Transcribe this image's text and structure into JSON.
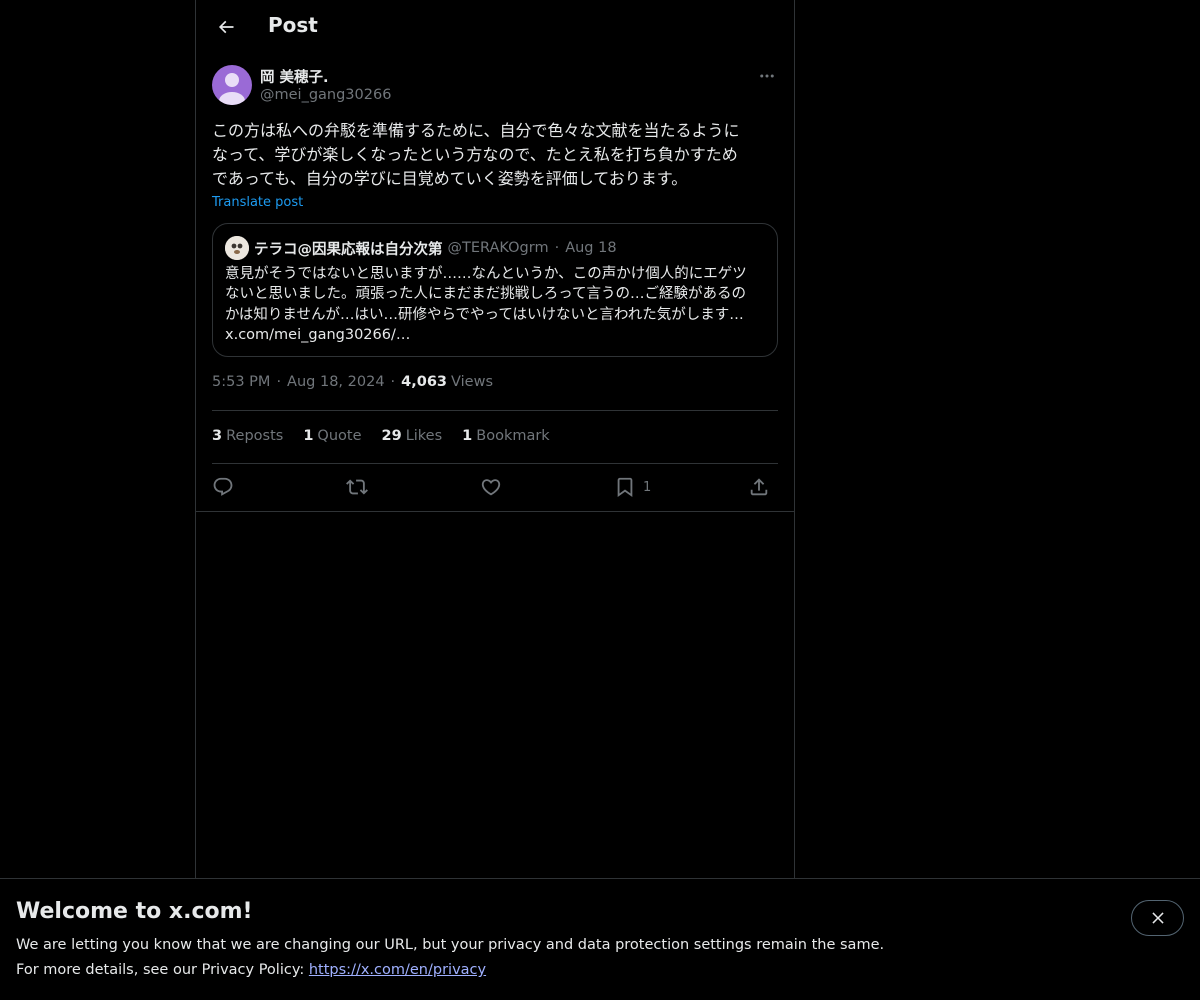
{
  "header": {
    "title": "Post"
  },
  "author": {
    "name": "岡 美穂子.",
    "handle": "@mei_gang30266"
  },
  "post": {
    "text": "この方は私への弁駁を準備するために、自分で色々な文献を当たるように\nなって、学びが楽しくなったという方なので、たとえ私を打ち負かすため\nであっても、自分の学びに目覚めていく姿勢を評価しております。",
    "translate_label": "Translate post"
  },
  "quote": {
    "name": "テラコ@因果応報は自分次第",
    "handle": "@TERAKOgrm",
    "separator": "·",
    "date": "Aug 18",
    "text": "意見がそうではないと思いますが……なんというか、この声かけ個人的にエゲツ\nないと思いました。頑張った人にまだまだ挑戦しろって言うの…ご経験があるの\nかは知りませんが…はい…研修やらでやってはいけないと言われた気がします…\nx.com/mei_gang30266/…"
  },
  "meta": {
    "time": "5:53 PM",
    "separator": "·",
    "date": "Aug 18, 2024",
    "views_count": "4,063",
    "views_label": "Views"
  },
  "stats": {
    "reposts_count": "3",
    "reposts_label": "Reposts",
    "quotes_count": "1",
    "quotes_label": "Quote",
    "likes_count": "29",
    "likes_label": "Likes",
    "bookmarks_count": "1",
    "bookmarks_label": "Bookmark"
  },
  "actions": {
    "reply_icon": "reply-icon",
    "repost_icon": "repost-icon",
    "like_icon": "heart-icon",
    "bookmark_icon": "bookmark-icon",
    "bookmark_count": "1",
    "share_icon": "share-icon"
  },
  "banner": {
    "title": "Welcome to x.com!",
    "line1": "We are letting you know that we are changing our URL, but your privacy and data protection settings remain the same.",
    "line2_prefix": "For more details, see our Privacy Policy: ",
    "link": "https://x.com/en/privacy"
  },
  "colors": {
    "background": "#000000",
    "text": "#e7e9ea",
    "muted": "#71767b",
    "accent": "#1d9bf0",
    "border": "#2f3336"
  }
}
